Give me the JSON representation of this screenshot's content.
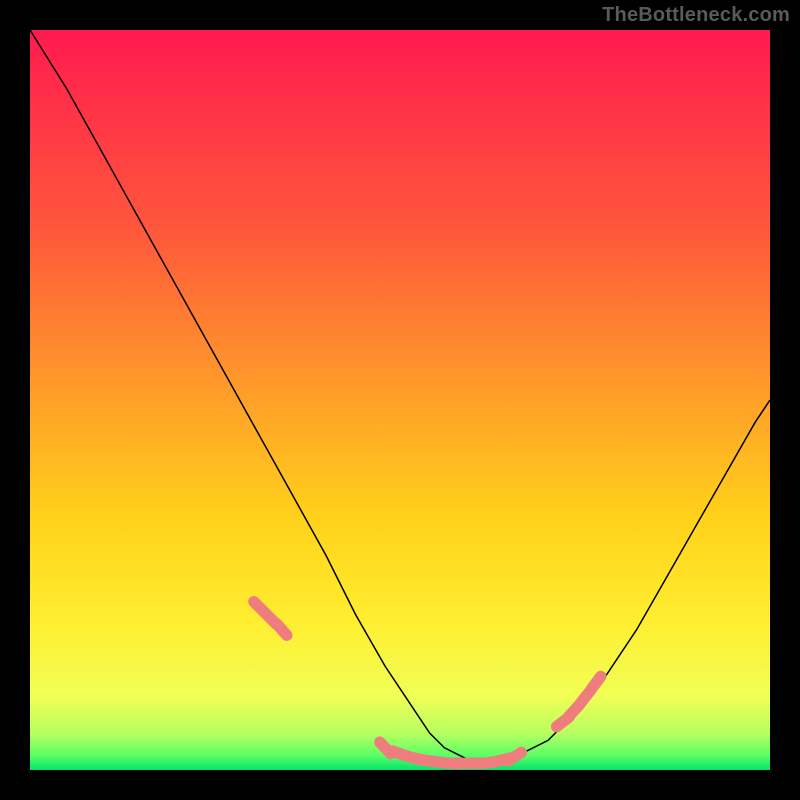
{
  "source_label": "TheBottleneck.com",
  "chart_data": {
    "type": "line",
    "title": "",
    "xlabel": "",
    "ylabel": "",
    "xlim": [
      0,
      100
    ],
    "ylim": [
      0,
      100
    ],
    "background_gradient": {
      "top": "#ff1a4f",
      "mid_upper": "#ff8a2a",
      "mid": "#ffe400",
      "mid_lower": "#ffff66",
      "bottom": "#00e56a"
    },
    "series": [
      {
        "name": "bottleneck-curve",
        "color": "#000000",
        "stroke_width": 1.5,
        "x": [
          0,
          5,
          10,
          15,
          20,
          25,
          30,
          35,
          40,
          44,
          48,
          50,
          52,
          54,
          56,
          58,
          60,
          62,
          66,
          70,
          74,
          78,
          82,
          86,
          90,
          94,
          98,
          100
        ],
        "y": [
          100,
          92,
          83,
          74,
          65,
          56,
          47,
          38,
          29,
          21,
          14,
          11,
          8,
          5,
          3,
          2,
          1,
          1,
          2,
          4,
          8,
          13,
          19,
          26,
          33,
          40,
          47,
          50
        ]
      },
      {
        "name": "highlight-dots",
        "color": "#f07d7d",
        "marker_radius": 6,
        "x": [
          31,
          32.5,
          34,
          48,
          50,
          52,
          53.5,
          55,
          57,
          58.5,
          60,
          62,
          64,
          65.5,
          72,
          73.5,
          75,
          76.5
        ],
        "y": [
          22,
          20.5,
          19,
          3,
          2.2,
          1.6,
          1.3,
          1.1,
          0.9,
          0.9,
          0.9,
          1.0,
          1.4,
          1.8,
          6.5,
          8,
          9.8,
          11.8
        ],
        "style_note": "rendered as short thick rounded dashes along the curve"
      }
    ],
    "annotations": []
  }
}
